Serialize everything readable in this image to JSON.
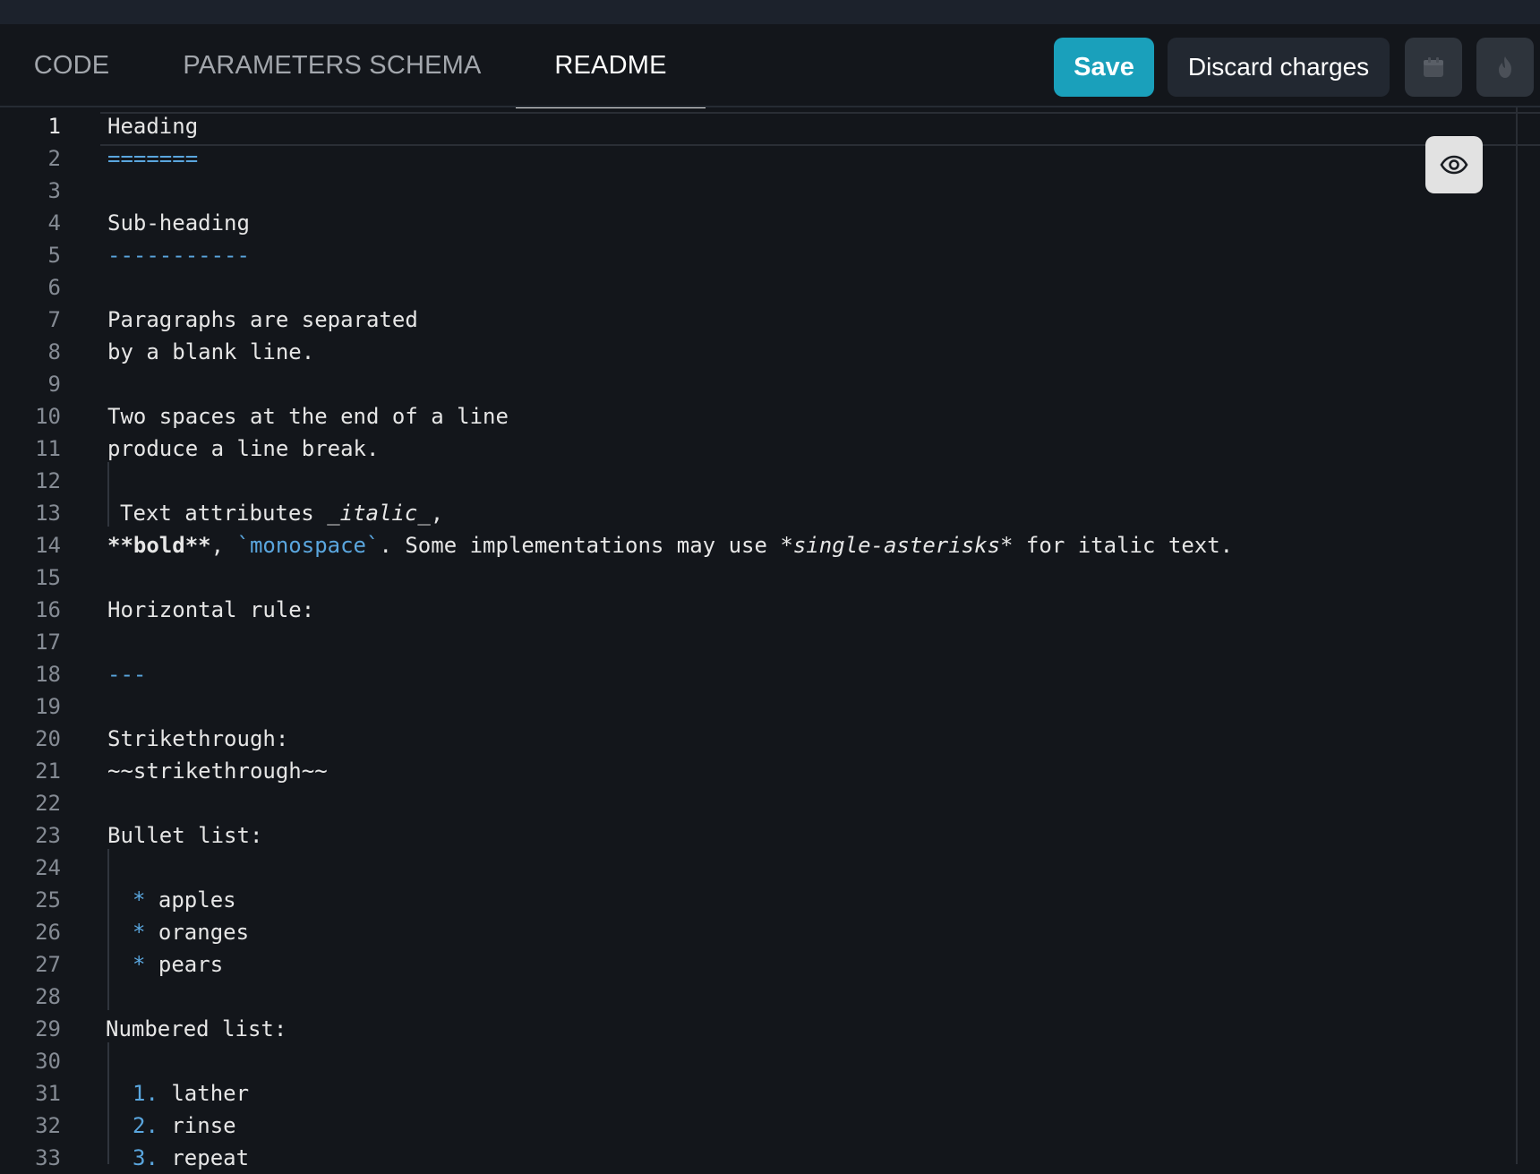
{
  "tabs": {
    "code": "CODE",
    "parameters_schema": "PARAMETERS SCHEMA",
    "readme": "README",
    "active": "README"
  },
  "toolbar": {
    "save_label": "Save",
    "discard_label": "Discard charges",
    "calendar_icon": "calendar-icon",
    "fire_icon": "fire-icon"
  },
  "editor": {
    "preview_icon": "eye-icon",
    "current_line": 1,
    "line_numbers": [
      "1",
      "2",
      "3",
      "4",
      "5",
      "6",
      "7",
      "8",
      "9",
      "10",
      "11",
      "12",
      "13",
      "14",
      "15",
      "16",
      "17",
      "18",
      "19",
      "20",
      "21",
      "22",
      "23",
      "24",
      "25",
      "26",
      "27",
      "28",
      "29",
      "30",
      "31",
      "32",
      "33"
    ],
    "lines": {
      "l1": "Heading",
      "l2": "=======",
      "l4": "Sub-heading",
      "l5": "-----------",
      "l7": "Paragraphs are separated",
      "l8": "by a blank line.",
      "l10": "Two spaces at the end of a line",
      "l11": "produce a line break.",
      "l13_prefix": "Text attributes ",
      "l13_italic": "_italic_",
      "l13_suffix": ",",
      "l14_bold": "**bold**",
      "l14_sep1": ", ",
      "l14_code": "`monospace`",
      "l14_mid": ". Some implementations may use ",
      "l14_italic": "*single-asterisks*",
      "l14_end": " for italic text.",
      "l16": "Horizontal rule:",
      "l18": "---",
      "l20": "Strikethrough:",
      "l21": "~~strikethrough~~",
      "l23": "Bullet list:",
      "l25_marker": "*",
      "l25_text": " apples",
      "l26_marker": "*",
      "l26_text": " oranges",
      "l27_marker": "*",
      "l27_text": " pears",
      "l29": "Numbered list:",
      "l31_marker": "1.",
      "l31_text": " lather",
      "l32_marker": "2.",
      "l32_text": " rinse",
      "l33_marker": "3.",
      "l33_text": " repeat"
    }
  },
  "colors": {
    "accent": "#1aa0bb",
    "markdown_syntax": "#5aa6de",
    "background": "#13161b"
  }
}
